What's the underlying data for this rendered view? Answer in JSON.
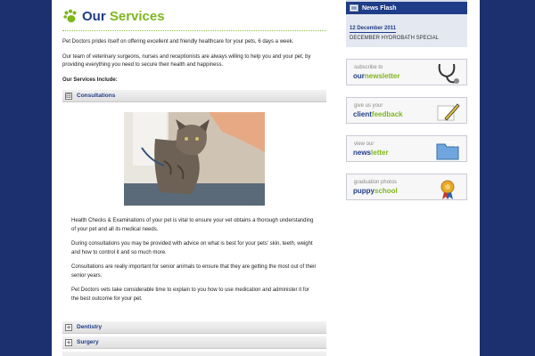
{
  "colors": {
    "brand_blue": "#1f3c88",
    "brand_green": "#7fb61e",
    "background_navy": "#1c2f6e"
  },
  "page": {
    "title_part1": "Our",
    "title_part2": "Services",
    "intro1": "Pet Doctors prides itself on offering excellent and friendly healthcare for your pets, 6 days a week.",
    "intro2": "Our team of veterinary surgeons, nurses and receptionists are always willing to help you and your pet, by providing everything you need to secure their health and happiness.",
    "services_heading": "Our Services Include:"
  },
  "sections": [
    {
      "label": "Consultations",
      "toggle": "⊟"
    },
    {
      "label": "Dentistry",
      "toggle": "+"
    },
    {
      "label": "Surgery",
      "toggle": "+"
    }
  ],
  "consultations": {
    "p1": "Health Checks & Examinations of your pet is vital to ensure your vet obtains a thorough understanding of your pet and all its medical needs.",
    "p2": "During consultations you may be provided with advice on what is best for your pets' skin, teeth, weight and how to control it and so much more.",
    "p3": "Consultations are really important for senior animals to ensure that they are getting the most out of their senior years.",
    "p4": "Pet Doctors vets take considerable time to explain to you how to use medication and administer it for the best outcome for your pet."
  },
  "news_flash": {
    "title": "News Flash",
    "date": "12 December 2011",
    "text": "DECEMBER HYDROBATH SPECIAL"
  },
  "promos": [
    {
      "small": "subscribe to",
      "big_a": "our",
      "big_b": "newsletter",
      "icon": "stethoscope-icon"
    },
    {
      "small": "give us your",
      "big_a": "client",
      "big_b": "feedback",
      "icon": "pen-icon"
    },
    {
      "small": "view our",
      "big_a": "news",
      "big_b": "letter",
      "icon": "folder-icon"
    },
    {
      "small": "graduation photos",
      "big_a": "puppy",
      "big_b": "school",
      "icon": "rosette-icon"
    }
  ]
}
